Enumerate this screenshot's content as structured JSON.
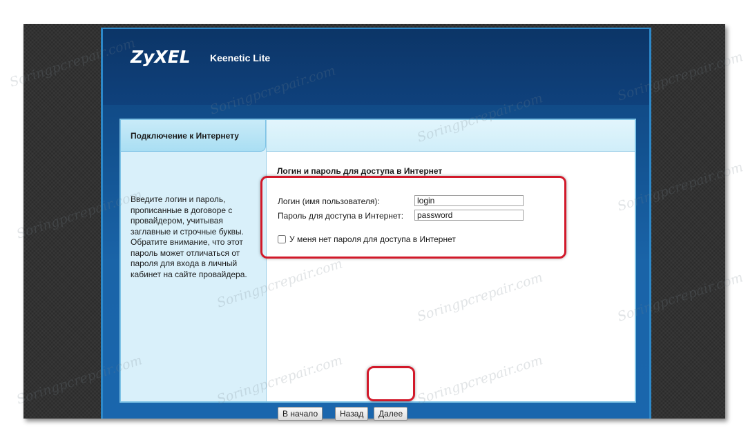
{
  "brand": {
    "logo": "ZyXEL",
    "model": "Keenetic Lite"
  },
  "sidebar": {
    "tab_label": "Подключение к Интернету",
    "help_text": "Введите логин и пароль, прописанные в договоре с провайдером, учитывая заглавные и строчные буквы. Обратите внимание, что этот пароль может отличаться от пароля для входа в личный кабинет на сайте провайдера."
  },
  "form": {
    "section_title": "Логин и пароль для доступа в Интернет",
    "login_label": "Логин (имя пользователя):",
    "login_value": "login",
    "password_label": "Пароль для доступа в Интернет:",
    "password_value": "password",
    "no_password_label": "У меня нет пароля для доступа в Интернет",
    "no_password_checked": false
  },
  "buttons": {
    "start": "В начало",
    "back": "Назад",
    "next": "Далее"
  },
  "watermark": "Soringpcrepair.com",
  "colors": {
    "highlight": "#d2192a",
    "header": "#0f417c",
    "panel_border": "#7ec3e6"
  }
}
